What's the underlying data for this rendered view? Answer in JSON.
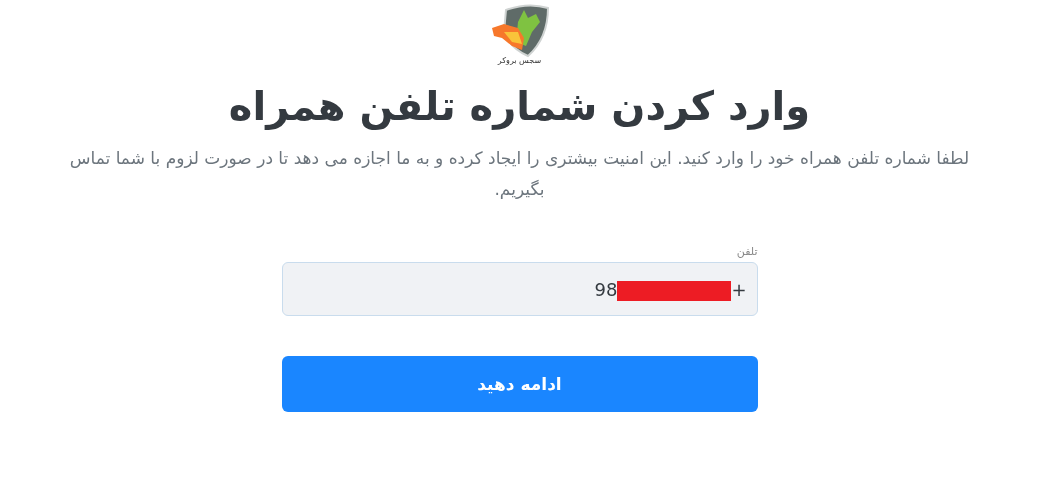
{
  "logo": {
    "caption": "سجس بروکر"
  },
  "title": "وارد کردن شماره تلفن همراه",
  "description": "لطفا شماره تلفن همراه خود را وارد کنید. این امنیت بیشتری را ایجاد کرده و به ما اجازه می دهد تا در صورت لزوم با شما تماس بگیریم.",
  "phone_field": {
    "label": "تلفن",
    "prefix": "+",
    "value": "98",
    "redacted": true
  },
  "submit_button": "ادامه دهید"
}
